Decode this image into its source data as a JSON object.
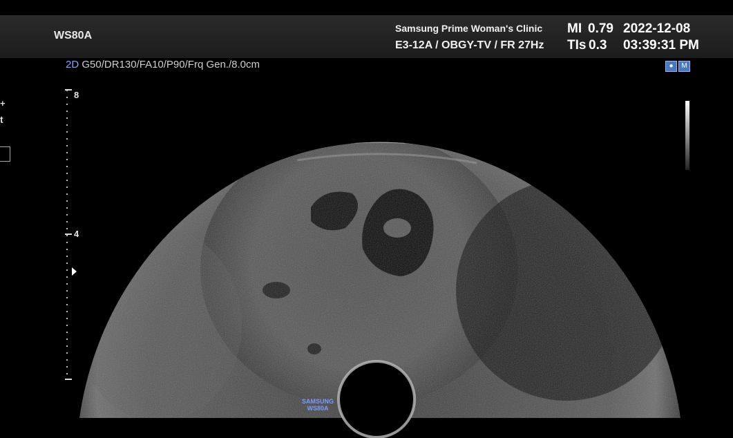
{
  "header": {
    "model": "WS80A",
    "clinic": "Samsung Prime Woman's Clinic",
    "probe_preset": "E3-12A / OBGY-TV / FR 27Hz",
    "mi_label": "MI",
    "mi_value": "0.79",
    "tis_label": "TIs",
    "tis_value": "0.3",
    "date": "2022-12-08",
    "time": "03:39:31 PM"
  },
  "image_params": {
    "mode": "2D",
    "settings": "G50/DR130/FA10/P90/Frq Gen./8.0cm"
  },
  "depth_scale": {
    "label_top": "8",
    "label_mid": "4"
  },
  "left_panel": {
    "plus": "+",
    "t": "t"
  },
  "watermark": {
    "line1": "SAMSUNG",
    "line2": "WS80A"
  },
  "icons": [
    "probe-icon",
    "mode-icon"
  ]
}
